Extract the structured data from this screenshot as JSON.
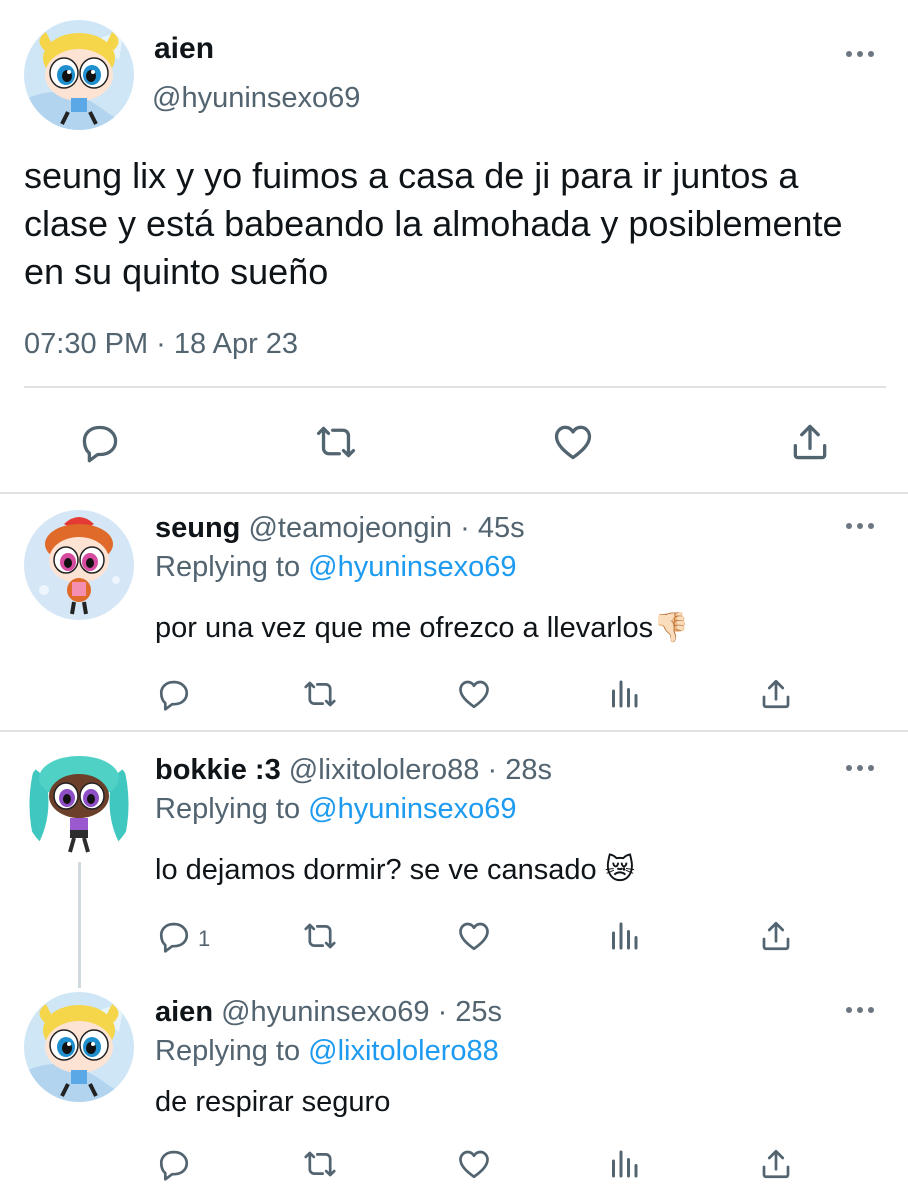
{
  "main_tweet": {
    "name": "aien",
    "handle": "@hyuninsexo69",
    "text": "seung lix y yo fuimos a casa de ji para ir juntos a clase y está babeando la almohada y posiblemente en su quinto sueño",
    "timestamp": "07:30 PM · 18 Apr 23",
    "actions": [
      "reply-icon",
      "retweet-icon",
      "like-icon",
      "share-icon"
    ]
  },
  "replies": [
    {
      "name": "seung",
      "handle": "@teamojeongin",
      "time": "· 45s",
      "replying_label": "Replying to",
      "replying_to": "@hyuninsexo69",
      "text": "por una vez que me ofrezco a llevarlos👎🏻",
      "reply_count": ""
    },
    {
      "name": "bokkie :3",
      "handle": "@lixitololero88",
      "time": "· 28s",
      "replying_label": "Replying to",
      "replying_to": "@hyuninsexo69",
      "text": "lo dejamos dormir? se ve cansado 😿",
      "reply_count": "1"
    },
    {
      "name": "aien",
      "handle": "@hyuninsexo69",
      "time": "· 25s",
      "replying_label": "Replying to",
      "replying_to": "@lixitololero88",
      "text": "de respirar seguro",
      "reply_count": ""
    }
  ],
  "colors": {
    "link": "#1d9bf0",
    "secondary_text": "#536471",
    "primary_text": "#0f1419",
    "divider": "#dfe3e6",
    "icon": "#536471"
  }
}
